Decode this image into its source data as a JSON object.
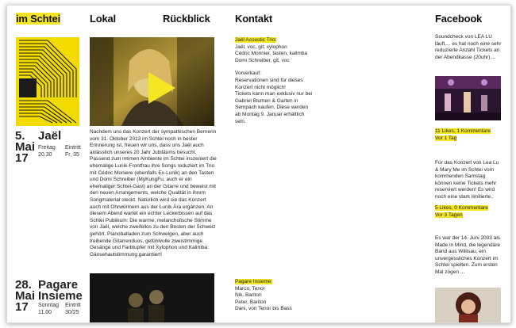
{
  "nav": {
    "home": "im Schtei",
    "lokal": "Lokal",
    "rueckblick": "Rückblick",
    "kontakt": "Kontakt",
    "facebook": "Facebook"
  },
  "colors": {
    "accent": "#f5e623",
    "logo_yellow": "#f2dc00"
  },
  "events": [
    {
      "date": "5.\nMai\n17",
      "title": "Jaël",
      "day_label": "Freitag",
      "time": "20.30",
      "entry_label": "Eintritt",
      "price": "Fr. 35",
      "description": "Nachdem uns das Konzert der sympathischen Bernerin vom 31. Oktober 2013 im Schtei noch in bester Erinnerung ist, freuen wir uns, dass uns Jaël auch anlässlich unseres 20 Jahr Jubiläums besucht. Passend zum intimen Ambiente im Schtei inszeniert die ehemalige Lunik-Frontfrau ihre Songs reduziert im Trio mit Cédric Moniere (ebenfalls Ex-Lunik) an den Tasten und Domi Schreiber (MyKungFu, auch er ein ehemaliger Schtei-Gast) an der Gitarre und beweist mit den neuen Arrangements, welche Qualität in ihrem Songmaterial steckt. Natürlich wird sie das Konzert auch mit Ohrwürmern aus der Lunik Ära ergänzen.   An diesem Abend wartet ein echter Leckerbissen auf das Schtei Publikum: Die warme, melancholische Stimme von Jaël, welche zweifellos zu den Besten der Schweiz gehört. Pianoballaden zum Schwelgen, aber auch treibende Gitarrenduos, gefühlvolle zweistimmige Gesänge und Farbtupfer mit Xylophon und Kalimba: Gänsehautstimmung garantiert!",
      "kontakt_title": "Jaël Acoustic Trio:",
      "kontakt_lineup": "Jaël, voc, git, xylophon\nCédric Monnier, tasten, kalimba\nDomi Schreiber, git, voc",
      "kontakt_vorverkauf": "Vorverkauf:\nReservationen sind für dieses Konzert nicht möglich!\nTickets kann man exklusiv nur bei Gabriel Blumen & Garten in Sempach kaufen. Diese werden ab Montag 9. Januar erhältlich sein."
    },
    {
      "date": "28.\nMai\n17",
      "title": "Pagare\nInsieme",
      "day_label": "Sonntag",
      "time": "11.00",
      "entry_label": "Eintritt",
      "price": "30/25",
      "kontakt_title": "Pagare Insieme:",
      "kontakt_lineup": "Marco, Tenor\nNik, Bariton\nPeter, Bariton\nDani, von Tenor bis Bass"
    }
  ],
  "facebook": [
    {
      "text": "Soundcheck von LEA LU läuft.... es hat noch eine sehr reduzierte Anzahl Tickets an der Abendkasse (20uhr)....",
      "likes": "11 Likes, 1 Kommentare",
      "ago": "Vor 1 Tag"
    },
    {
      "text": "Für das Konzert von Lea Lu & Mary Me im Schtei vom kommenden Samstag können keine Tickets mehr reserviert werden! Es wird noch eine stark limitierte..",
      "likes": "5 Likes, 0 Kommentare",
      "ago": "Vor 3 Tagen"
    },
    {
      "text": "Es war der 14. Juni 2003 als Made in Mind, die legendäre Band aus Willisau, ein unvergessliches Konzert im Schtei spielten. Zum ersten Mal zogen ..."
    }
  ]
}
